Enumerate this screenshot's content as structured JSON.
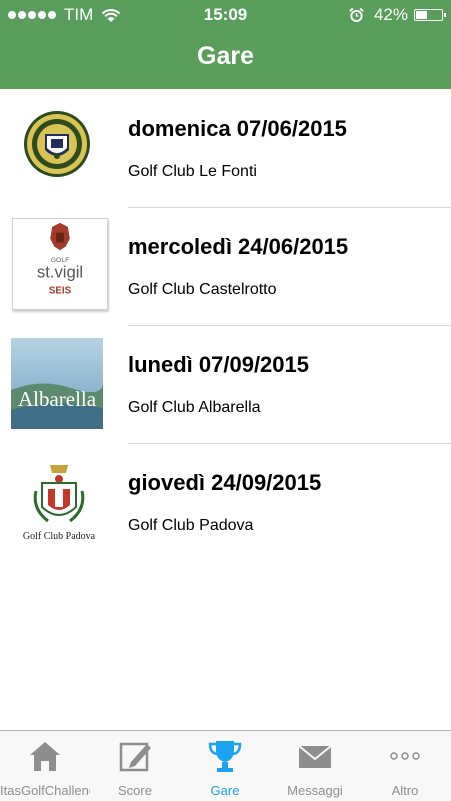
{
  "status": {
    "carrier": "TIM",
    "time": "15:09",
    "battery": "42%",
    "battery_level": 0.42,
    "icons": [
      "signal-dots-icon",
      "wifi-icon",
      "alarm-icon",
      "battery-icon"
    ]
  },
  "nav": {
    "title": "Gare"
  },
  "logos": {
    "st_vigil": {
      "top": "GOLF",
      "name": "st.vigil",
      "sub": "SEIS"
    },
    "albarella": {
      "name": "Albarella"
    },
    "padova": {
      "caption": "Golf Club Padova"
    }
  },
  "events": [
    {
      "date": "domenica 07/06/2015",
      "venue": "Golf Club Le Fonti"
    },
    {
      "date": "mercoledì 24/06/2015",
      "venue": "Golf Club Castelrotto"
    },
    {
      "date": "lunedì 07/09/2015",
      "venue": "Golf Club Albarella"
    },
    {
      "date": "giovedì 24/09/2015",
      "venue": "Golf Club Padova"
    }
  ],
  "tabs": [
    {
      "label": "ItasGolfChallenge",
      "icon": "house-icon"
    },
    {
      "label": "Score",
      "icon": "pencil-icon"
    },
    {
      "label": "Gare",
      "icon": "trophy-icon",
      "active": true
    },
    {
      "label": "Messaggi",
      "icon": "envelope-icon"
    },
    {
      "label": "Altro",
      "icon": "more-icon"
    }
  ],
  "colors": {
    "header": "#5a9e5b",
    "active_tab": "#1aa3ee",
    "inactive_tab": "#8e8e8e"
  }
}
